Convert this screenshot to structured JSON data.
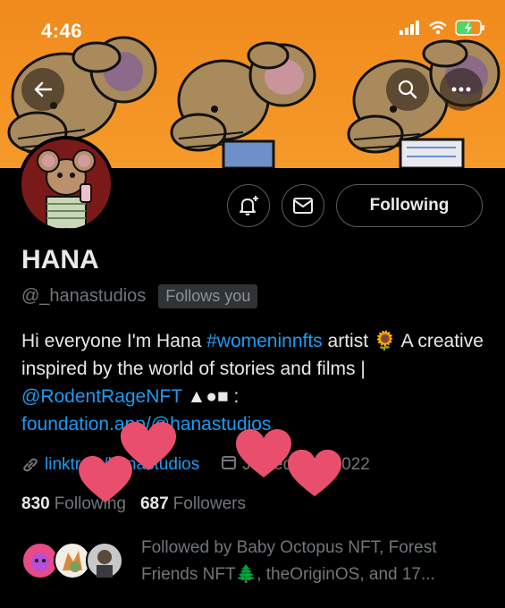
{
  "status_bar": {
    "time": "4:46"
  },
  "profile": {
    "name": "HANA",
    "handle": "@_hanastudios",
    "follows_you": "Follows you",
    "bio": {
      "part1": "Hi everyone I'm Hana ",
      "hashtag": "#womeninnfts",
      "part2": " artist 🌻 A creative inspired by the world of stories and films | ",
      "mention": "@RodentRageNFT",
      "symbols": " ▲●■ : ",
      "link": "foundation.app/@hanastudios"
    },
    "website": "linktr.ee/hanastudios",
    "joined": "Joined July 2022",
    "following_count": "830",
    "following_label": "Following",
    "followers_count": "687",
    "followers_label": "Followers",
    "followed_by": "Followed by Baby Octopus NFT, Forest Friends NFT🌲, theOriginOS, and 17..."
  },
  "buttons": {
    "following": "Following"
  },
  "colors": {
    "banner": "#f08a1c",
    "link": "#1d9bf0",
    "muted": "#71767b",
    "heart": "#e94f6c"
  }
}
